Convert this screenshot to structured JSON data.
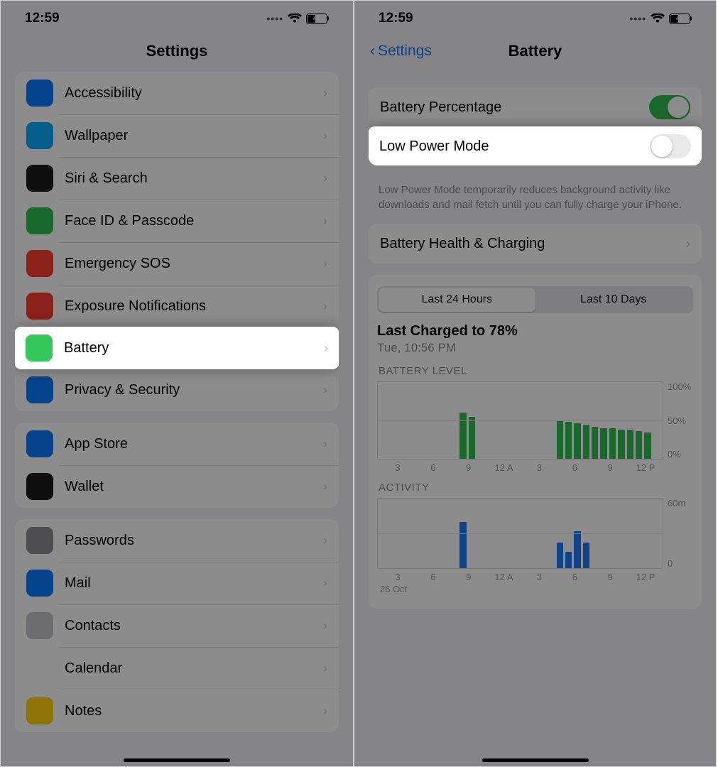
{
  "status": {
    "time": "12:59",
    "battery_pct": "41"
  },
  "left": {
    "title": "Settings",
    "groups": [
      {
        "items": [
          {
            "label": "Accessibility",
            "icon": "#0a7aff",
            "name": "accessibility"
          },
          {
            "label": "Wallpaper",
            "icon": "#0aa9ff",
            "name": "wallpaper"
          },
          {
            "label": "Siri & Search",
            "icon": "#1c1c1e",
            "name": "siri-search"
          },
          {
            "label": "Face ID & Passcode",
            "icon": "#30c050",
            "name": "faceid"
          },
          {
            "label": "Emergency SOS",
            "icon": "#ff3b30",
            "name": "emergency-sos"
          },
          {
            "label": "Exposure Notifications",
            "icon": "#ff3b30",
            "name": "exposure"
          },
          {
            "label": "Battery",
            "icon": "#34c759",
            "name": "battery",
            "highlight": true
          },
          {
            "label": "Privacy & Security",
            "icon": "#0a7aff",
            "name": "privacy"
          }
        ]
      },
      {
        "items": [
          {
            "label": "App Store",
            "icon": "#0a7aff",
            "name": "app-store"
          },
          {
            "label": "Wallet",
            "icon": "#1c1c1e",
            "name": "wallet"
          }
        ]
      },
      {
        "items": [
          {
            "label": "Passwords",
            "icon": "#8e8e93",
            "name": "passwords"
          },
          {
            "label": "Mail",
            "icon": "#0a7aff",
            "name": "mail"
          },
          {
            "label": "Contacts",
            "icon": "#c7c7cc",
            "name": "contacts"
          },
          {
            "label": "Calendar",
            "icon": "#ffffff",
            "name": "calendar"
          },
          {
            "label": "Notes",
            "icon": "#ffd60a",
            "name": "notes"
          }
        ]
      }
    ]
  },
  "right": {
    "back": "Settings",
    "title": "Battery",
    "rows": {
      "batt_pct": {
        "label": "Battery Percentage",
        "on": true
      },
      "lpm": {
        "label": "Low Power Mode",
        "on": false,
        "highlight": true
      },
      "health": {
        "label": "Battery Health & Charging"
      }
    },
    "lpm_desc": "Low Power Mode temporarily reduces background activity like downloads and mail fetch until you can fully charge your iPhone.",
    "seg": {
      "options": [
        "Last 24 Hours",
        "Last 10 Days"
      ],
      "selected": 0
    },
    "last_charge_head": "Last Charged to 78%",
    "last_charge_sub": "Tue, 10:56 PM",
    "chart_data": {
      "battery_level": {
        "type": "bar",
        "title": "BATTERY LEVEL",
        "ylabels": [
          "100%",
          "50%",
          "0%"
        ],
        "xlabels": [
          "3",
          "6",
          "9",
          "12 A",
          "3",
          "6",
          "9",
          "12 P"
        ],
        "series": [
          {
            "name": "level",
            "color": "#30c050",
            "values": [
              0,
              0,
              0,
              0,
              0,
              0,
              0,
              0,
              0,
              60,
              55,
              0,
              0,
              0,
              0,
              0,
              0,
              0,
              0,
              0,
              50,
              48,
              46,
              44,
              42,
              40,
              40,
              38,
              38,
              36,
              34,
              0
            ]
          }
        ],
        "ylim": [
          0,
          100
        ]
      },
      "activity": {
        "type": "bar",
        "title": "ACTIVITY",
        "ylabels": [
          "60m",
          "",
          "0"
        ],
        "xlabels": [
          "3",
          "6",
          "9",
          "12 A",
          "3",
          "6",
          "9",
          "12 P"
        ],
        "date_label": "26 Oct",
        "series": [
          {
            "name": "activity",
            "color": "#1a7aff",
            "values": [
              0,
              0,
              0,
              0,
              0,
              0,
              0,
              0,
              0,
              40,
              0,
              0,
              0,
              0,
              0,
              0,
              0,
              0,
              0,
              0,
              22,
              14,
              32,
              22,
              0,
              0,
              0,
              0,
              0,
              0,
              0,
              0
            ]
          }
        ],
        "ylim": [
          0,
          60
        ]
      }
    }
  }
}
